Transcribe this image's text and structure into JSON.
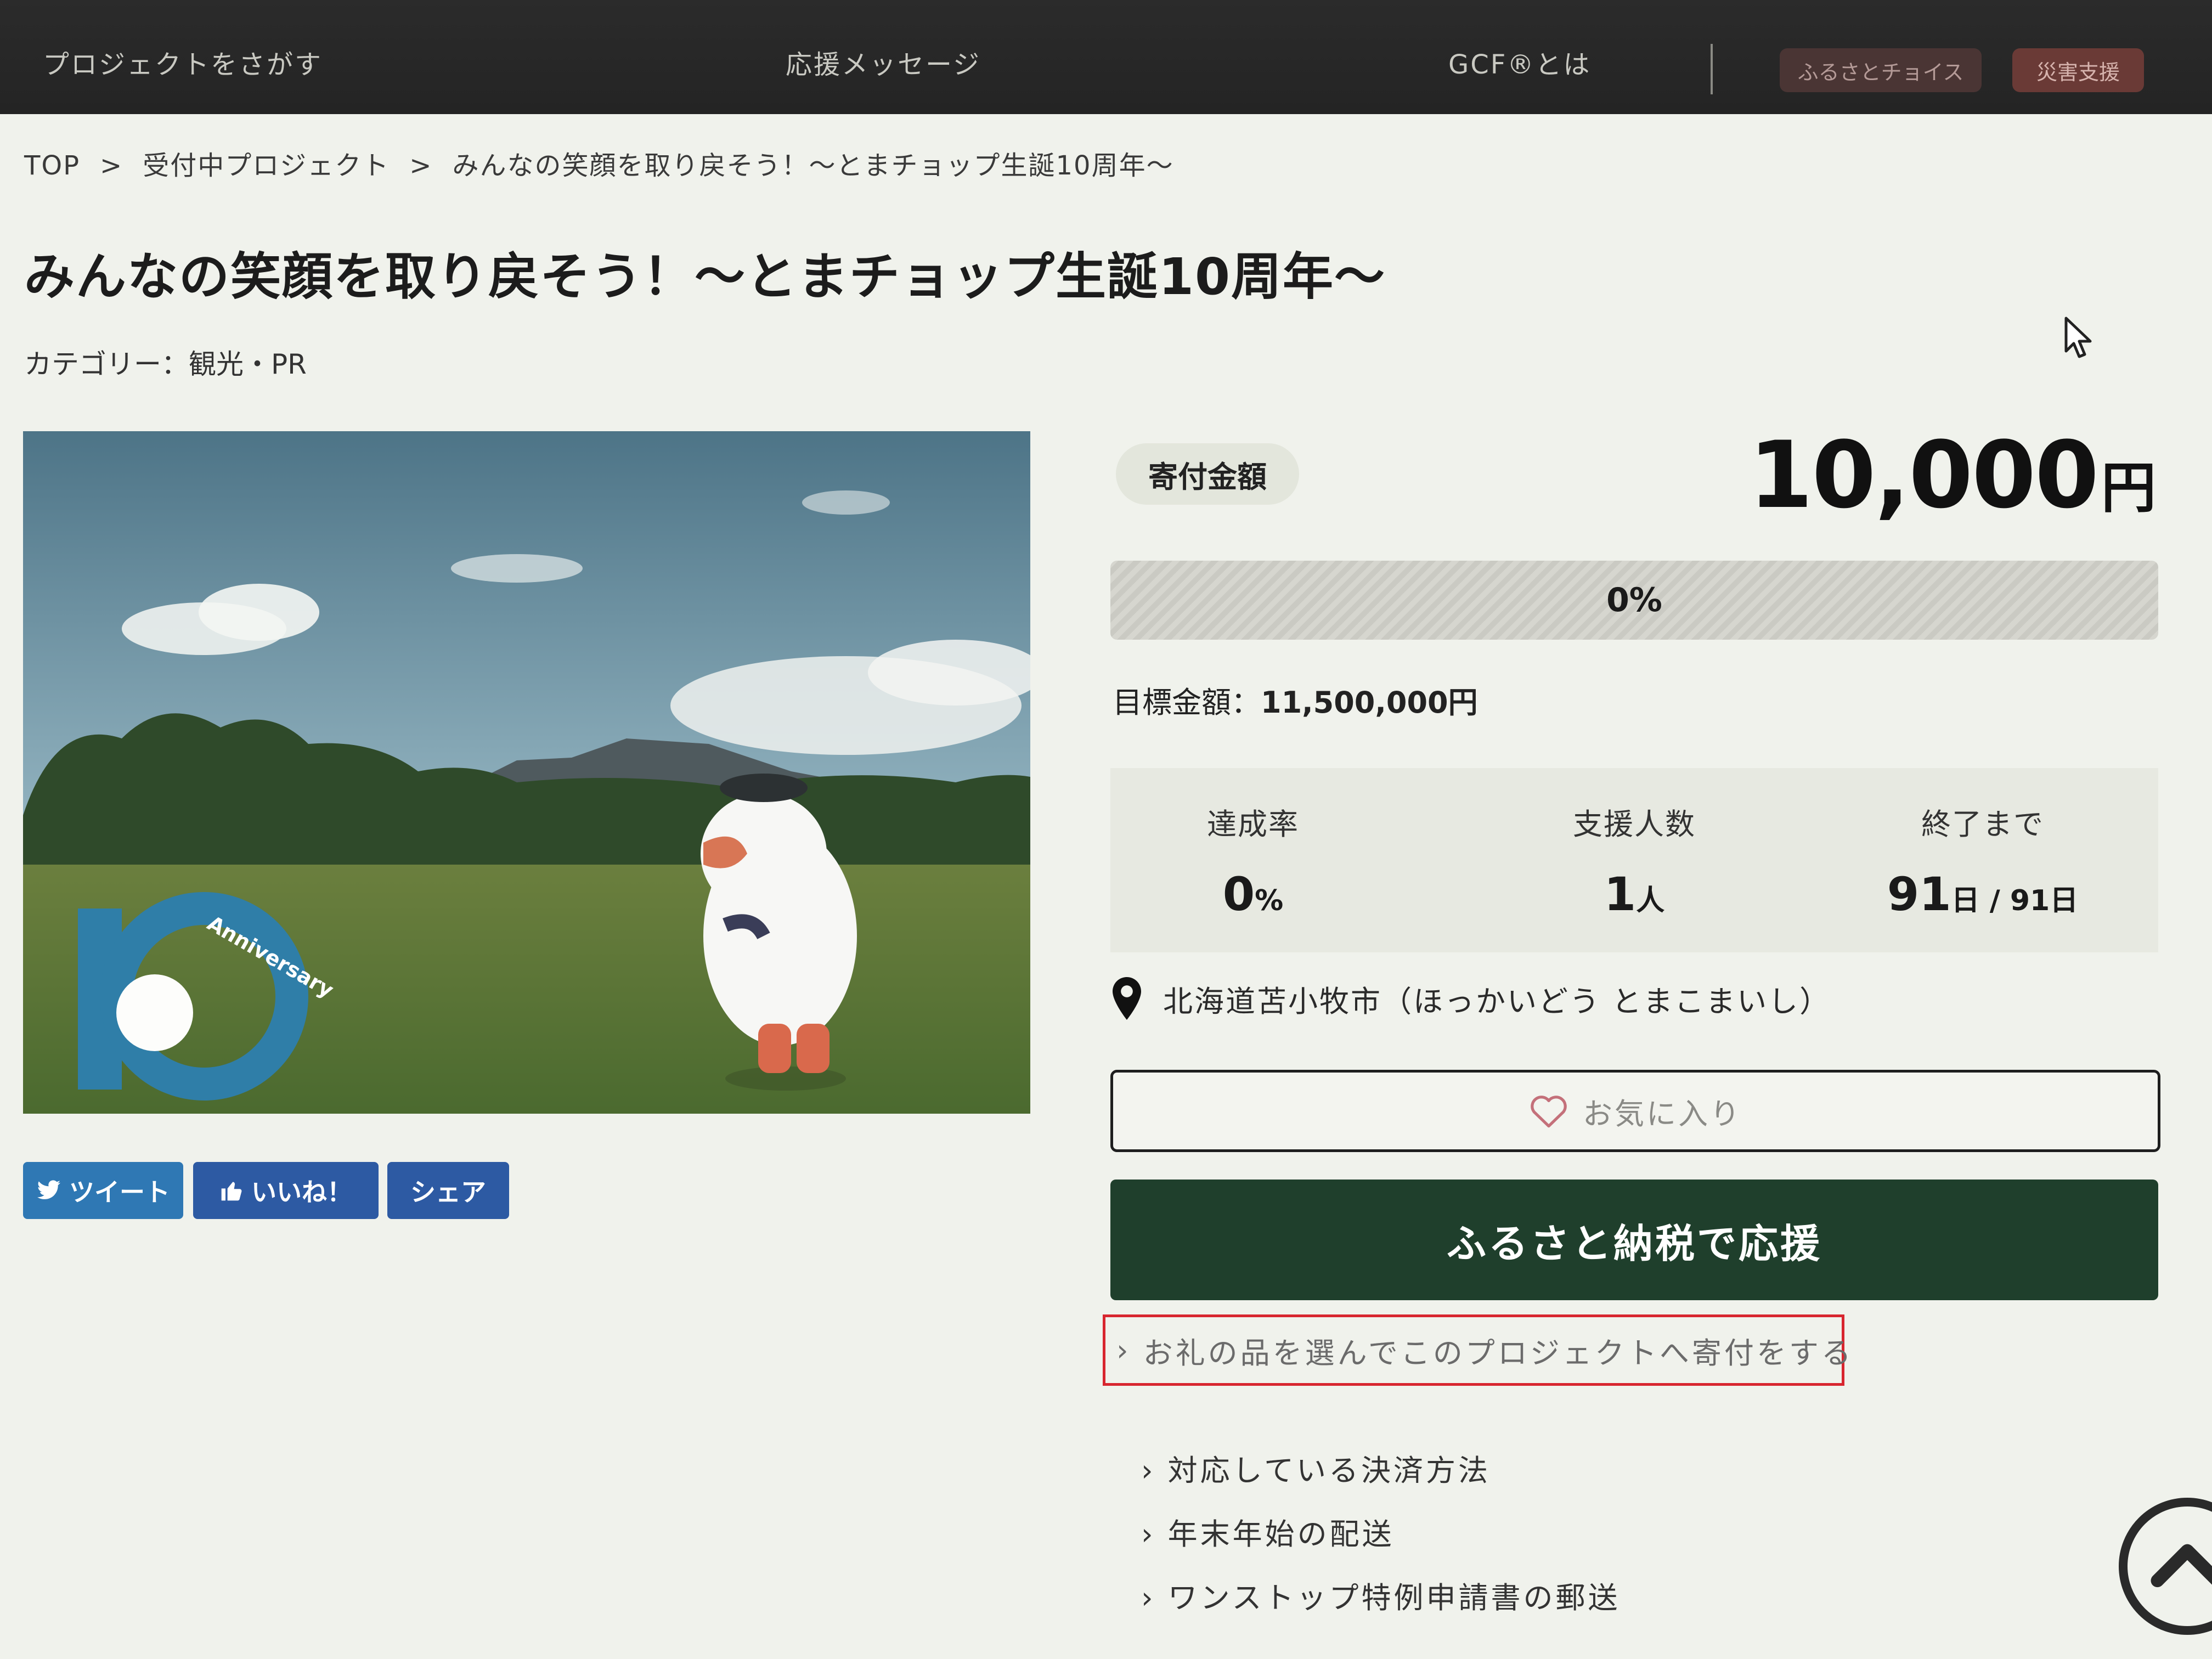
{
  "header": {
    "nav": [
      "プロジェクトをさがす",
      "応援メッセージ",
      "GCF®とは"
    ],
    "pills": [
      "ふるさとチョイス",
      "災害支援"
    ]
  },
  "breadcrumb": [
    "TOP",
    "受付中プロジェクト",
    "みんなの笑顔を取り戻そう！～とまチョップ生誕10周年～"
  ],
  "breadcrumb_separator": ">",
  "title": "みんなの笑顔を取り戻そう！～とまチョップ生誕10周年～",
  "category": "カテゴリー：観光・PR",
  "photo": {
    "badge_text": "Anniversary"
  },
  "share": {
    "tweet": "ツイート",
    "like": "いいね！",
    "share": "シェア"
  },
  "donation": {
    "label": "寄付金額",
    "amount": "10,000",
    "unit": "円",
    "progress_text": "0%",
    "progress_fraction": 0,
    "goal_label": "目標金額：",
    "goal_value": "11,500,000円"
  },
  "stats": [
    {
      "label": "達成率",
      "value": "0",
      "unit": "%"
    },
    {
      "label": "支援人数",
      "value": "1",
      "unit": "人"
    },
    {
      "label": "終了まで",
      "value": "91",
      "unit": "日 / 91日"
    }
  ],
  "location": "北海道苫小牧市（ほっかいどう とまこまいし）",
  "favorite_label": "お気に入り",
  "donate_button": "ふるさと納税で応援",
  "select_gift_link": "お礼の品を選んでこのプロジェクトへ寄付をする",
  "links": [
    "対応している決済方法",
    "年末年始の配送",
    "ワンストップ特例申請書の郵送"
  ],
  "colors": {
    "header_bg": "#2b2b2b",
    "donate_bg": "#1f3f2c",
    "highlight_border": "#d8262f",
    "share_blue": "#2f78b4"
  },
  "icons": [
    "twitter-bird-icon",
    "thumbs-up-icon",
    "map-pin-icon",
    "heart-outline-icon",
    "chevron-right-icon",
    "scroll-top-icon",
    "mouse-cursor-icon"
  ]
}
